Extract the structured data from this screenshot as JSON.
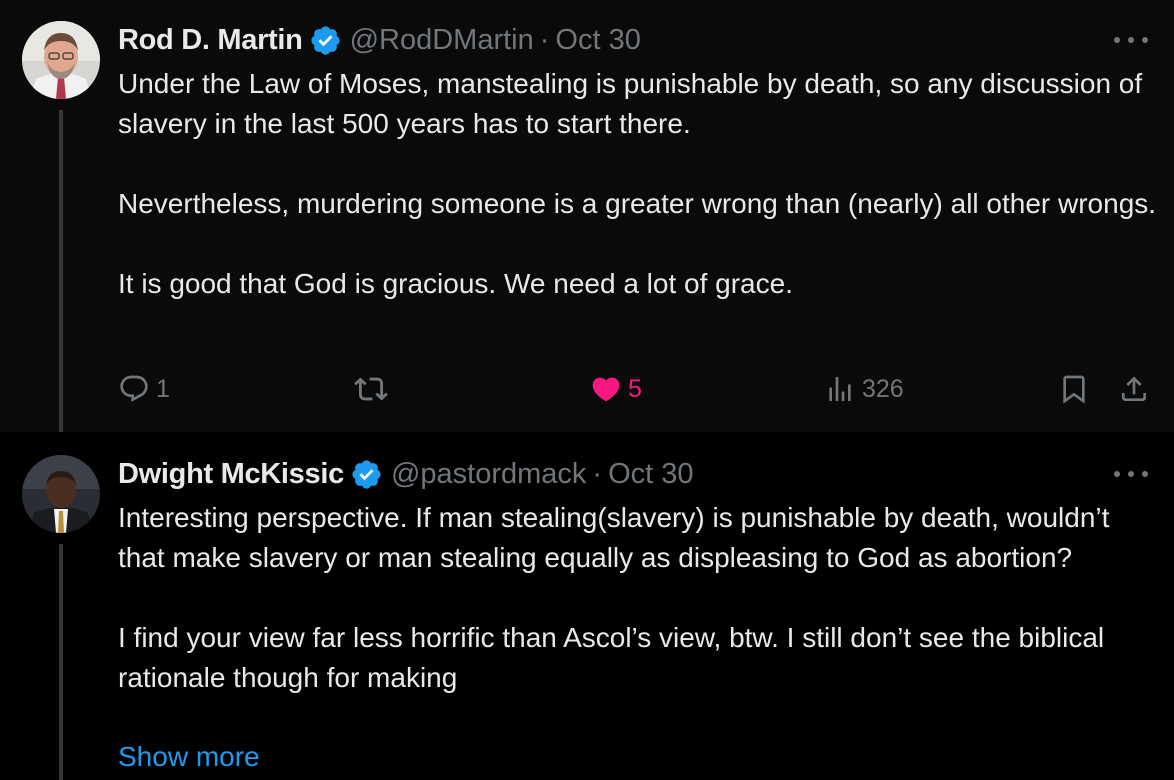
{
  "tweets": [
    {
      "name": "Rod D. Martin",
      "handle": "@RodDMartin",
      "separator": "·",
      "date": "Oct 30",
      "paragraphs": [
        "Under the Law of Moses, manstealing is punishable by death, so any discussion of slavery in the last 500 years has to start there.",
        "Nevertheless, murdering someone is a greater wrong than (nearly) all other wrongs.",
        "It is good that God is gracious. We need a lot of grace."
      ],
      "replies": "1",
      "retweets": "",
      "likes": "5",
      "views": "326"
    },
    {
      "name": "Dwight McKissic",
      "handle": "@pastordmack",
      "separator": "·",
      "date": "Oct 30",
      "paragraphs": [
        "Interesting perspective. If man stealing(slavery) is punishable by death, wouldn’t that make slavery or man stealing equally as displeasing to God as abortion?",
        "I find your view far less horrific than Ascol’s view, btw. I still don’t see the biblical rationale though for making"
      ],
      "show_more": "Show more"
    }
  ],
  "icons": {
    "verified": "verified-badge-icon",
    "more": "more-options-icon",
    "reply": "reply-icon",
    "retweet": "retweet-icon",
    "like": "heart-icon",
    "views": "views-icon",
    "bookmark": "bookmark-icon",
    "share": "share-icon"
  },
  "colors": {
    "background": "#000000",
    "text": "#e7e9ea",
    "muted": "#71767b",
    "accent": "#1d9bf0",
    "like": "#f91880"
  }
}
